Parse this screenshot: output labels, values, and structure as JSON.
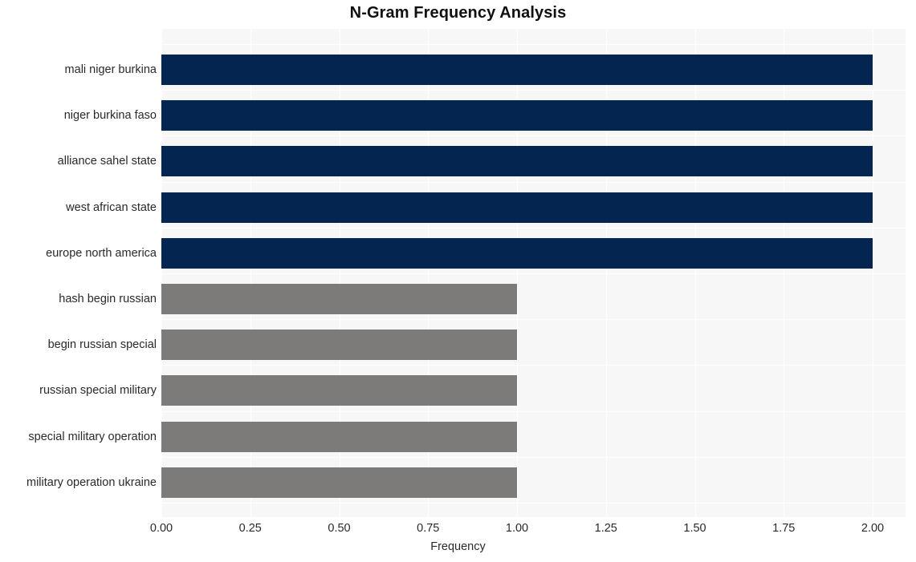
{
  "chart_data": {
    "type": "bar",
    "orientation": "horizontal",
    "title": "N-Gram Frequency Analysis",
    "xlabel": "Frequency",
    "ylabel": "",
    "categories": [
      "mali niger burkina",
      "niger burkina faso",
      "alliance sahel state",
      "west african state",
      "europe north america",
      "hash begin russian",
      "begin russian special",
      "russian special military",
      "special military operation",
      "military operation ukraine"
    ],
    "values": [
      2,
      2,
      2,
      2,
      2,
      1,
      1,
      1,
      1,
      1
    ],
    "bar_colors": [
      "#042550",
      "#042550",
      "#042550",
      "#042550",
      "#042550",
      "#7C7B79",
      "#7C7B79",
      "#7C7B79",
      "#7C7B79",
      "#7C7B79"
    ],
    "xlim": [
      0.0,
      2.0
    ],
    "xticks": [
      0.0,
      0.25,
      0.5,
      0.75,
      1.0,
      1.25,
      1.5,
      1.75,
      2.0
    ],
    "xtick_labels": [
      "0.00",
      "0.25",
      "0.50",
      "0.75",
      "1.00",
      "1.25",
      "1.50",
      "1.75",
      "2.00"
    ],
    "grid": true,
    "grid_color": "#FFFFFF",
    "plot_background": "#F7F7F8",
    "figure_background": "#FFFFFF",
    "legend": null,
    "accent_high": "#042550",
    "accent_low": "#7C7B79"
  }
}
